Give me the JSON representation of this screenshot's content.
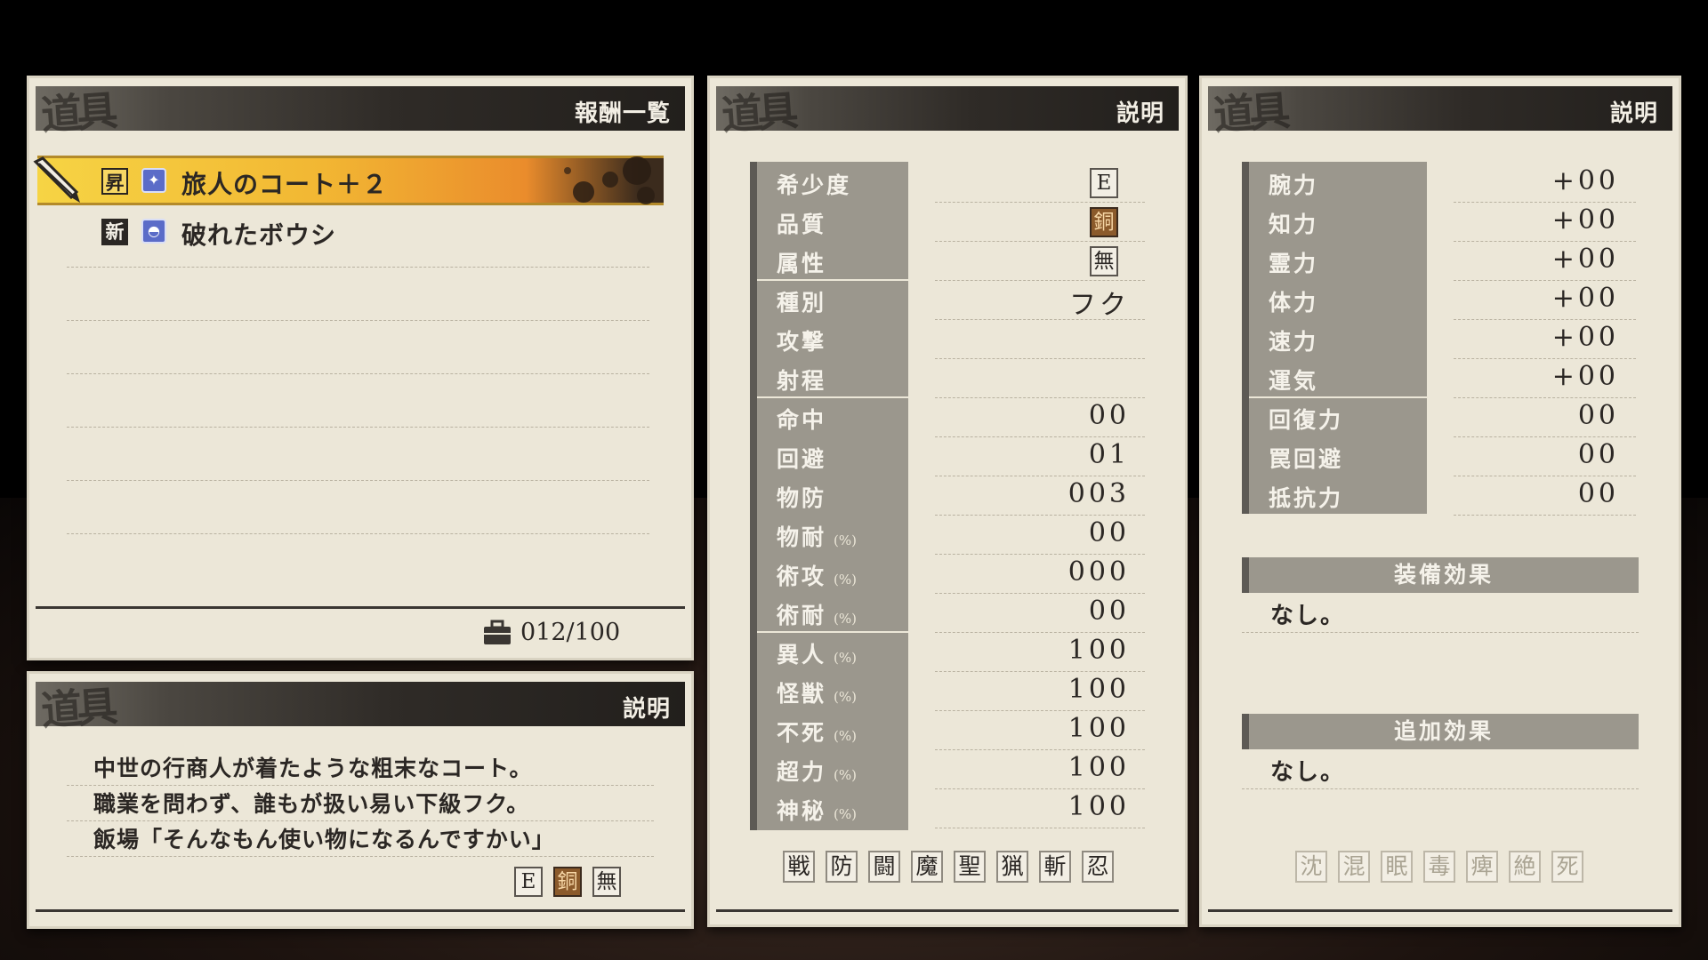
{
  "reward_panel": {
    "title": "報酬一覧",
    "items": [
      {
        "tag": "昇",
        "name": "旅人のコート＋２",
        "selected": true
      },
      {
        "tag": "新",
        "name": "破れたボウシ",
        "selected": false
      }
    ],
    "count": "012/100",
    "count_icon": "briefcase-icon"
  },
  "desc_panel": {
    "title": "説明",
    "lines": [
      "中世の行商人が着たような粗末なコート。",
      "職業を問わず、誰もが扱い易い下級フク。",
      "飯場「そんなもん使い物になるんですかい」"
    ],
    "badges": [
      "E",
      "銅",
      "無"
    ]
  },
  "stats_panel": {
    "title": "説明",
    "rows": [
      {
        "label": "希少度",
        "pct": "",
        "value": "E",
        "kind": "badge"
      },
      {
        "label": "品質",
        "pct": "",
        "value": "銅",
        "kind": "badge-copper"
      },
      {
        "label": "属性",
        "pct": "",
        "value": "無",
        "kind": "badge"
      },
      {
        "label": "種別",
        "pct": "",
        "value": "フク",
        "kind": "text"
      },
      {
        "label": "攻撃",
        "pct": "",
        "value": "",
        "kind": "text"
      },
      {
        "label": "射程",
        "pct": "",
        "value": "",
        "kind": "text"
      },
      {
        "label": "命中",
        "pct": "",
        "value": "00",
        "kind": "num"
      },
      {
        "label": "回避",
        "pct": "",
        "value": "01",
        "kind": "num"
      },
      {
        "label": "物防",
        "pct": "",
        "value": "003",
        "kind": "num"
      },
      {
        "label": "物耐",
        "pct": "(%)",
        "value": "00",
        "kind": "num"
      },
      {
        "label": "術攻",
        "pct": "(%)",
        "value": "000",
        "kind": "num"
      },
      {
        "label": "術耐",
        "pct": "(%)",
        "value": "00",
        "kind": "num"
      },
      {
        "label": "異人",
        "pct": "(%)",
        "value": "100",
        "kind": "num"
      },
      {
        "label": "怪獣",
        "pct": "(%)",
        "value": "100",
        "kind": "num"
      },
      {
        "label": "不死",
        "pct": "(%)",
        "value": "100",
        "kind": "num"
      },
      {
        "label": "超力",
        "pct": "(%)",
        "value": "100",
        "kind": "num"
      },
      {
        "label": "神秘",
        "pct": "(%)",
        "value": "100",
        "kind": "num"
      }
    ],
    "class_icons": [
      "戦",
      "防",
      "闘",
      "魔",
      "聖",
      "猟",
      "斬",
      "忍"
    ]
  },
  "attr_panel": {
    "title": "説明",
    "rows": [
      {
        "label": "腕力",
        "value": "+00"
      },
      {
        "label": "知力",
        "value": "+00"
      },
      {
        "label": "霊力",
        "value": "+00"
      },
      {
        "label": "体力",
        "value": "+00"
      },
      {
        "label": "速力",
        "value": "+00"
      },
      {
        "label": "運気",
        "value": "+00"
      },
      {
        "label": "回復力",
        "value": "00"
      },
      {
        "label": "罠回避",
        "value": "00"
      },
      {
        "label": "抵抗力",
        "value": "00"
      }
    ],
    "equip_effect_title": "装備効果",
    "equip_effect_text": "なし。",
    "extra_effect_title": "追加効果",
    "extra_effect_text": "なし。",
    "status_icons": [
      "沈",
      "混",
      "眠",
      "毒",
      "痺",
      "絶",
      "死"
    ]
  }
}
